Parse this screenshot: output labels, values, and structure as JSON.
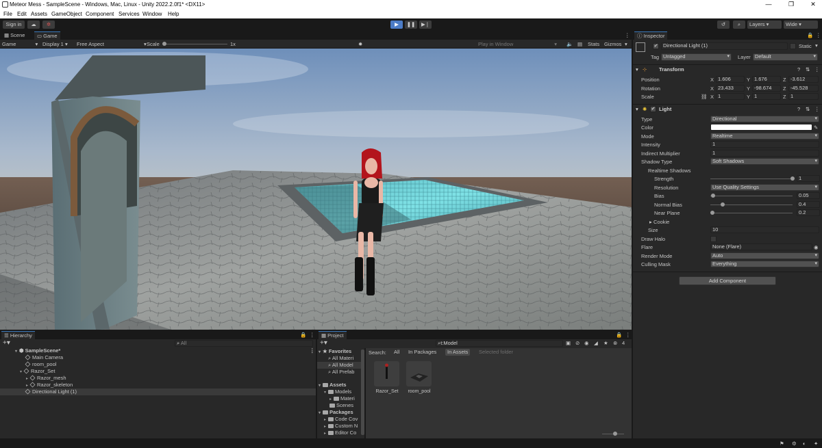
{
  "window": {
    "title": "Meteor Mess - SampleScene - Windows, Mac, Linux - Unity 2022.2.0f1* <DX11>"
  },
  "menu": [
    "File",
    "Edit",
    "Assets",
    "GameObject",
    "Component",
    "Services",
    "Window",
    "Help"
  ],
  "toolbar": {
    "sign_in": "Sign in",
    "layers": "Layers",
    "layout": "Wide"
  },
  "scene_tabs": [
    "Scene",
    "Game"
  ],
  "game_bar": {
    "game": "Game",
    "display": "Display 1",
    "aspect": "Free Aspect",
    "scale_label": "Scale",
    "scale_value": "1x",
    "play_in": "Play in Window",
    "stats": "Stats",
    "gizmos": "Gizmos"
  },
  "hierarchy": {
    "title": "Hierarchy",
    "search_placeholder": "All",
    "items": [
      {
        "label": "SampleScene*",
        "level": 0
      },
      {
        "label": "Main Camera",
        "level": 1
      },
      {
        "label": "room_pool",
        "level": 1
      },
      {
        "label": "Razor_Set",
        "level": 1
      },
      {
        "label": "Razor_mesh",
        "level": 2
      },
      {
        "label": "Razor_skeleton",
        "level": 2
      },
      {
        "label": "Directional Light (1)",
        "level": 1,
        "selected": true
      }
    ]
  },
  "project": {
    "title": "Project",
    "search_value": "t:Model",
    "filter_count": "4",
    "tree": [
      {
        "label": "Favorites",
        "bold": true
      },
      {
        "label": "All Materi"
      },
      {
        "label": "All Model",
        "selected": true
      },
      {
        "label": "All Prefab"
      },
      {
        "label": "Assets",
        "bold": true
      },
      {
        "label": "Models"
      },
      {
        "label": "Materi"
      },
      {
        "label": "Scenes"
      },
      {
        "label": "Packages",
        "bold": true
      },
      {
        "label": "Code Cov"
      },
      {
        "label": "Custom N"
      },
      {
        "label": "Editor Co"
      }
    ],
    "search_label": "Search:",
    "search_scopes": [
      "All",
      "In Packages",
      "In Assets",
      "Selected folder"
    ],
    "assets": [
      "Razor_Set",
      "room_pool"
    ]
  },
  "inspector": {
    "title": "Inspector",
    "object_name": "Directional Light (1)",
    "static": "Static",
    "tag_label": "Tag",
    "tag": "Untagged",
    "layer_label": "Layer",
    "layer": "Default",
    "transform": {
      "title": "Transform",
      "position": [
        "1.606",
        "1.676",
        "-3.612"
      ],
      "rotation": [
        "23.433",
        "-98.674",
        "-45.528"
      ],
      "scale": [
        "1",
        "1",
        "1"
      ],
      "labels": [
        "Position",
        "Rotation",
        "Scale"
      ]
    },
    "light": {
      "title": "Light",
      "rows": [
        {
          "label": "Type",
          "value": "Directional",
          "kind": "dropdown"
        },
        {
          "label": "Color",
          "value": "",
          "kind": "color"
        },
        {
          "label": "Mode",
          "value": "Realtime",
          "kind": "dropdown"
        },
        {
          "label": "Intensity",
          "value": "1",
          "kind": "field"
        },
        {
          "label": "Indirect Multiplier",
          "value": "1",
          "kind": "field"
        },
        {
          "label": "Shadow Type",
          "value": "Soft Shadows",
          "kind": "dropdown"
        },
        {
          "label": "Realtime Shadows",
          "value": "",
          "kind": "header"
        },
        {
          "label": "Strength",
          "value": "1",
          "kind": "slider",
          "level": 1.0
        },
        {
          "label": "Resolution",
          "value": "Use Quality Settings",
          "kind": "dropdown"
        },
        {
          "label": "Bias",
          "value": "0.05",
          "kind": "slider",
          "level": 0.025
        },
        {
          "label": "Normal Bias",
          "value": "0.4",
          "kind": "slider",
          "level": 0.13
        },
        {
          "label": "Near Plane",
          "value": "0.2",
          "kind": "slider",
          "level": 0.02
        },
        {
          "label": "Cookie",
          "value": "",
          "kind": "foldout"
        },
        {
          "label": "Size",
          "value": "10",
          "kind": "field"
        },
        {
          "label": "Draw Halo",
          "value": "",
          "kind": "checkbox"
        },
        {
          "label": "Flare",
          "value": "None (Flare)",
          "kind": "object"
        },
        {
          "label": "Render Mode",
          "value": "Auto",
          "kind": "dropdown"
        },
        {
          "label": "Culling Mask",
          "value": "Everything",
          "kind": "dropdown"
        }
      ]
    },
    "add_component": "Add Component"
  }
}
